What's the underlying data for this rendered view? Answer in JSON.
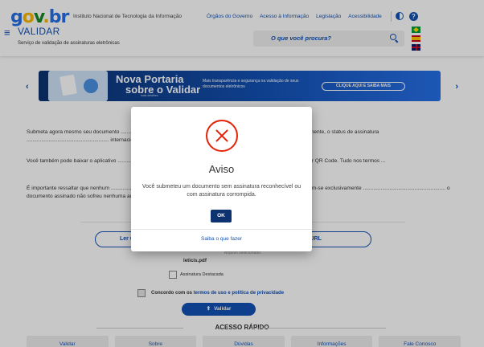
{
  "header": {
    "logo": {
      "g": "g",
      "o": "o",
      "v": "v",
      "dot": ".",
      "br": "br"
    },
    "institute": "Instituto Nacional de Tecnologia da Informação",
    "top_links": [
      "Órgãos do Governo",
      "Acesso à Informação",
      "Legislação",
      "Acessibilidade"
    ],
    "app_title": "VALIDAR",
    "app_subtitle": "Serviço de validação de assinaturas eletrônicas",
    "search_placeholder": "O que você procura?",
    "menu_icon": "≡",
    "help_icon": "?",
    "languages": [
      "pt-BR",
      "es",
      "en"
    ]
  },
  "carousel": {
    "prev": "‹",
    "next": "›",
    "banner_title_1": "Nova Portaria",
    "banner_title_2": "sobre o Validar",
    "banner_small": "mais detalhes",
    "banner_text": "Mais transparência e segurança na validação de seus documentos eletrônicos",
    "banner_cta": "CLIQUE AQUI E SAIBA MAIS"
  },
  "content": {
    "p1": "Submeta agora mesmo seu documento ........................................................ do governo e descubra online, e instantaneamente, o status de assinatura ........................................................ internacionais de reconhecimento mútuo para atender às suas necessidades.",
    "p2": "Você também pode baixar o aplicativo ........................................................ mentos e certificados de atributo acessíveis por QR Code. Tudo nos termos ...",
    "p3": "É importante ressaltar que nenhum ........................................................ racionais do ITI. Os resultados da validação limitam-se exclusivamente ........................................................ o documento assinado não sofreu nenhuma adulteração após a assinatura.",
    "btn_left": "Ler Q",
    "btn_right": "ar URL",
    "under_label": "Arquivo selecionado:",
    "filename": "leticis.pdf",
    "chk_detached": "Assinatura Destacada",
    "terms_prefix": "Concordo com os ",
    "terms_link": "termos de uso e política de privacidade",
    "validar_btn": "Validar",
    "validar_icon": "⬆",
    "quick_title": "ACESSO RÁPIDO",
    "quick_cards": [
      "Validar",
      "Sobre",
      "Dúvidas",
      "Informações",
      "Fale Conosco"
    ]
  },
  "modal": {
    "title": "Aviso",
    "message": "Você submeteu um documento sem assinatura reconhecível ou com assinatura corrompida.",
    "ok": "OK",
    "link": "Saiba o que fazer"
  },
  "colors": {
    "primary": "#1351b4",
    "dark_blue": "#0c326f",
    "error": "#e52207"
  }
}
